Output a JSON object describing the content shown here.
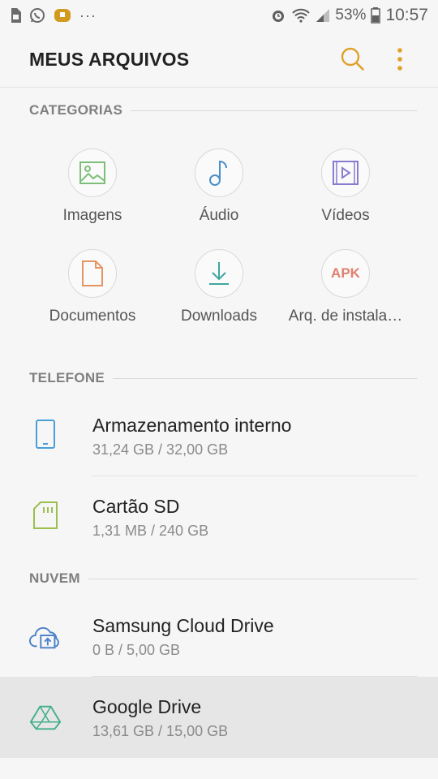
{
  "status_bar": {
    "battery": "53%",
    "time": "10:57",
    "notification_more": "···"
  },
  "app_bar": {
    "title": "MEUS ARQUIVOS"
  },
  "sections": {
    "categories": "CATEGORIAS",
    "phone": "TELEFONE",
    "cloud": "NUVEM"
  },
  "categories": [
    {
      "label": "Imagens",
      "icon": "image-icon",
      "color": "#7dbf7a"
    },
    {
      "label": "Áudio",
      "icon": "music-note-icon",
      "color": "#4a8fc8"
    },
    {
      "label": "Vídeos",
      "icon": "video-icon",
      "color": "#8b7bd0"
    },
    {
      "label": "Documentos",
      "icon": "document-icon",
      "color": "#e59562"
    },
    {
      "label": "Downloads",
      "icon": "download-icon",
      "color": "#3ea6a0"
    },
    {
      "label": "Arq. de instala…",
      "icon": "apk-icon",
      "icon_text": "APK",
      "color": "#e0806e"
    }
  ],
  "phone_storage": [
    {
      "title": "Armazenamento interno",
      "subtitle": "31,24 GB / 32,00 GB",
      "icon": "phone-icon"
    },
    {
      "title": "Cartão SD",
      "subtitle": "1,31 MB / 240 GB",
      "icon": "sd-card-icon"
    }
  ],
  "cloud_storage": [
    {
      "title": "Samsung Cloud Drive",
      "subtitle": "0 B / 5,00 GB",
      "icon": "cloud-upload-icon"
    },
    {
      "title": "Google Drive",
      "subtitle": "13,61 GB / 15,00 GB",
      "icon": "google-drive-icon"
    }
  ]
}
